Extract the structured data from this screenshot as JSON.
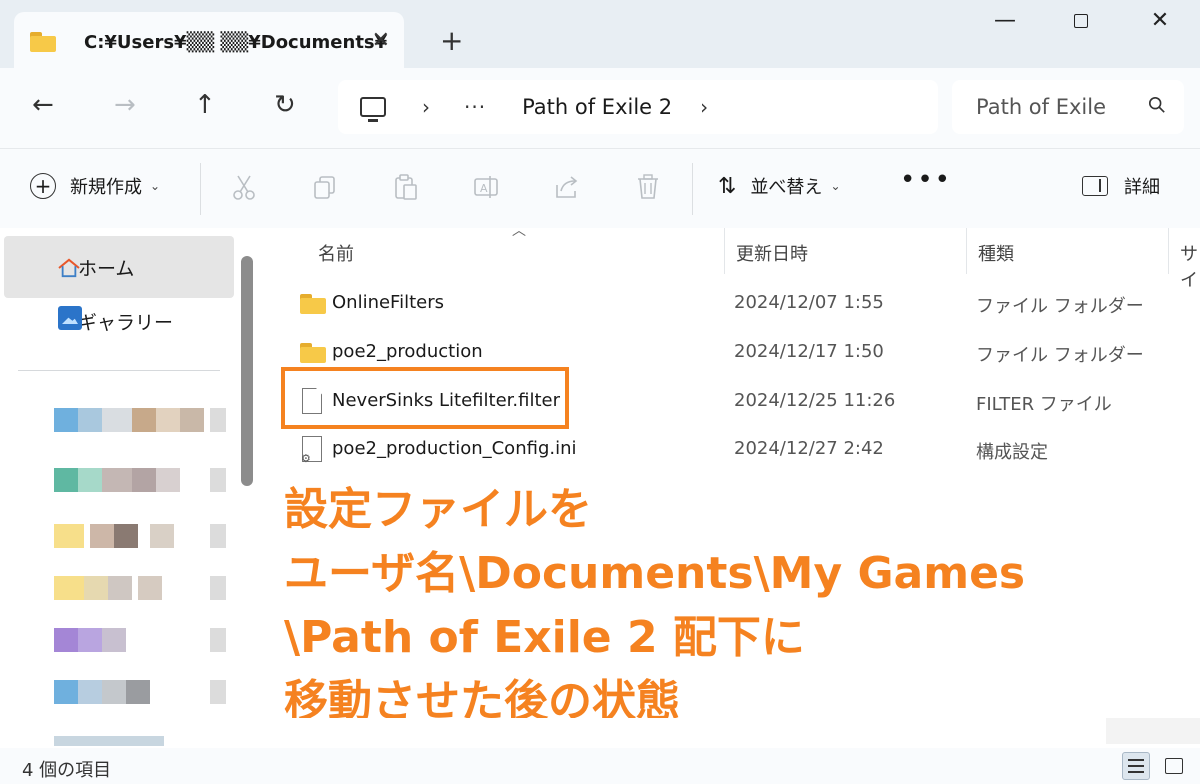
{
  "window": {
    "tab_title": "C:¥Users¥▒▒ ▒▒¥Documents¥",
    "new_tab_symbol": "+",
    "close_symbol": "✕",
    "minimize_symbol": "—"
  },
  "nav": {
    "back": "←",
    "forward": "→",
    "up": "↑",
    "refresh": "↻",
    "address_sep": "›",
    "address_overflow": "···",
    "address_path": "Path of Exile 2",
    "search_placeholder": "Path of Exile"
  },
  "toolbar": {
    "new_label": "新規作成",
    "sort_label": "並べ替え",
    "more_label": "•••",
    "details_label": "詳細"
  },
  "sidebar": {
    "items": [
      {
        "label": "ホーム"
      },
      {
        "label": "ギャラリー"
      }
    ]
  },
  "columns": {
    "name": "名前",
    "modified": "更新日時",
    "type": "種類",
    "size": "サイ"
  },
  "files": [
    {
      "name": "OnlineFilters",
      "modified": "2024/12/07 1:55",
      "type": "ファイル フォルダー",
      "kind": "folder"
    },
    {
      "name": "poe2_production",
      "modified": "2024/12/17 1:50",
      "type": "ファイル フォルダー",
      "kind": "folder"
    },
    {
      "name": "NeverSinks Litefilter.filter",
      "modified": "2024/12/25 11:26",
      "type": "FILTER ファイル",
      "kind": "file"
    },
    {
      "name": "poe2_production_Config.ini",
      "modified": "2024/12/27 2:42",
      "type": "構成設定",
      "kind": "ini"
    }
  ],
  "annotation": {
    "line1": "設定ファイルを",
    "line2": "ユーザ名\\Documents\\My Games",
    "line3": "\\Path of Exile 2 配下に",
    "line4": "移動させた後の状態",
    "color": "#f58220"
  },
  "status": {
    "item_count": "4 個の項目"
  },
  "colors": {
    "accent_orange": "#f58220",
    "folder_yellow": "#f7c948"
  }
}
